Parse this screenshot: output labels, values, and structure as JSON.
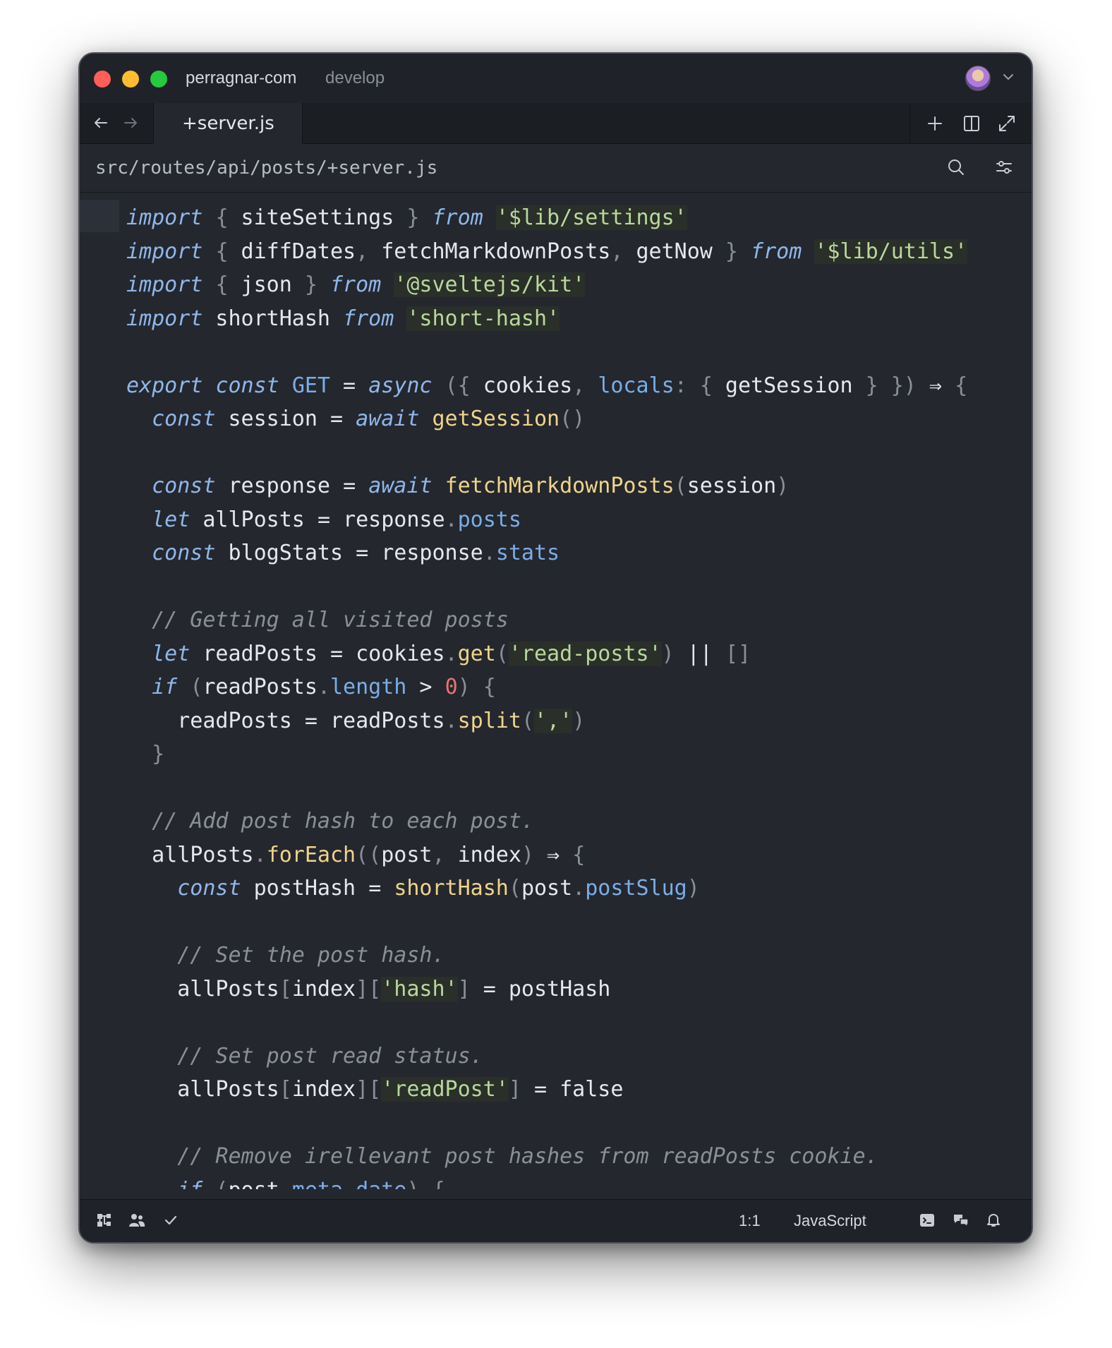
{
  "window": {
    "project_name": "perragnar-com",
    "branch_name": "develop"
  },
  "tabs": [
    {
      "label": "+server.js",
      "active": true
    }
  ],
  "path_bar": {
    "path": "src/routes/api/posts/+server.js"
  },
  "icons": {
    "back": "arrow-left-icon",
    "forward": "arrow-right-icon",
    "new_tab": "plus-icon",
    "split": "split-pane-icon",
    "expand": "expand-icon",
    "search": "search-icon",
    "settings": "sliders-icon",
    "project_tree": "project-tree-icon",
    "collab": "people-icon",
    "diagnostics": "check-icon",
    "terminal": "terminal-icon",
    "assistant": "chat-icon",
    "notifications": "bell-icon"
  },
  "colors": {
    "editor_bg": "#24272e",
    "keyword": "#8fb7ea",
    "function": "#f0d48a",
    "string": "#b8d89b",
    "property": "#79aee8",
    "comment": "#8a8f98",
    "number": "#e57373"
  },
  "code_lines": [
    [
      [
        "kw",
        "import"
      ],
      [
        "op",
        " "
      ],
      [
        "pn",
        "{"
      ],
      [
        "id",
        " siteSettings "
      ],
      [
        "pn",
        "}"
      ],
      [
        "op",
        " "
      ],
      [
        "kw",
        "from"
      ],
      [
        "op",
        " "
      ],
      [
        "str",
        "'$lib/settings'"
      ]
    ],
    [
      [
        "kw",
        "import"
      ],
      [
        "op",
        " "
      ],
      [
        "pn",
        "{"
      ],
      [
        "id",
        " diffDates"
      ],
      [
        "pn",
        ","
      ],
      [
        "id",
        " fetchMarkdownPosts"
      ],
      [
        "pn",
        ","
      ],
      [
        "id",
        " getNow "
      ],
      [
        "pn",
        "}"
      ],
      [
        "op",
        " "
      ],
      [
        "kw",
        "from"
      ],
      [
        "op",
        " "
      ],
      [
        "str",
        "'$lib/utils'"
      ]
    ],
    [
      [
        "kw",
        "import"
      ],
      [
        "op",
        " "
      ],
      [
        "pn",
        "{"
      ],
      [
        "id",
        " json "
      ],
      [
        "pn",
        "}"
      ],
      [
        "op",
        " "
      ],
      [
        "kw",
        "from"
      ],
      [
        "op",
        " "
      ],
      [
        "str",
        "'@sveltejs/kit'"
      ]
    ],
    [
      [
        "kw",
        "import"
      ],
      [
        "id",
        " shortHash "
      ],
      [
        "kw",
        "from"
      ],
      [
        "op",
        " "
      ],
      [
        "str",
        "'short-hash'"
      ]
    ],
    [],
    [
      [
        "kw",
        "export"
      ],
      [
        "op",
        " "
      ],
      [
        "kw",
        "const"
      ],
      [
        "op",
        " "
      ],
      [
        "prop",
        "GET"
      ],
      [
        "op",
        " = "
      ],
      [
        "kw",
        "async"
      ],
      [
        "op",
        " "
      ],
      [
        "pn",
        "({"
      ],
      [
        "id",
        " cookies"
      ],
      [
        "pn",
        ","
      ],
      [
        "op",
        " "
      ],
      [
        "prop",
        "locals"
      ],
      [
        "pn",
        ":"
      ],
      [
        "op",
        " "
      ],
      [
        "pn",
        "{"
      ],
      [
        "id",
        " getSession "
      ],
      [
        "pn",
        "}"
      ],
      [
        "op",
        " "
      ],
      [
        "pn",
        "})"
      ],
      [
        "op",
        " ⇒ "
      ],
      [
        "pn",
        "{"
      ]
    ],
    [
      [
        "op",
        "  "
      ],
      [
        "kw",
        "const"
      ],
      [
        "id",
        " session "
      ],
      [
        "op",
        "= "
      ],
      [
        "kw",
        "await"
      ],
      [
        "op",
        " "
      ],
      [
        "fn",
        "getSession"
      ],
      [
        "pn",
        "()"
      ]
    ],
    [],
    [
      [
        "op",
        "  "
      ],
      [
        "kw",
        "const"
      ],
      [
        "id",
        " response "
      ],
      [
        "op",
        "= "
      ],
      [
        "kw",
        "await"
      ],
      [
        "op",
        " "
      ],
      [
        "fn",
        "fetchMarkdownPosts"
      ],
      [
        "pn",
        "("
      ],
      [
        "id",
        "session"
      ],
      [
        "pn",
        ")"
      ]
    ],
    [
      [
        "op",
        "  "
      ],
      [
        "kw",
        "let"
      ],
      [
        "id",
        " allPosts "
      ],
      [
        "op",
        "= "
      ],
      [
        "id",
        "response"
      ],
      [
        "pn",
        "."
      ],
      [
        "prop",
        "posts"
      ]
    ],
    [
      [
        "op",
        "  "
      ],
      [
        "kw",
        "const"
      ],
      [
        "id",
        " blogStats "
      ],
      [
        "op",
        "= "
      ],
      [
        "id",
        "response"
      ],
      [
        "pn",
        "."
      ],
      [
        "prop",
        "stats"
      ]
    ],
    [],
    [
      [
        "op",
        "  "
      ],
      [
        "cm",
        "// Getting all visited posts"
      ]
    ],
    [
      [
        "op",
        "  "
      ],
      [
        "kw",
        "let"
      ],
      [
        "id",
        " readPosts "
      ],
      [
        "op",
        "= "
      ],
      [
        "id",
        "cookies"
      ],
      [
        "pn",
        "."
      ],
      [
        "fn",
        "get"
      ],
      [
        "pn",
        "("
      ],
      [
        "str",
        "'read-posts'"
      ],
      [
        "pn",
        ")"
      ],
      [
        "op",
        " || "
      ],
      [
        "pn",
        "[]"
      ]
    ],
    [
      [
        "op",
        "  "
      ],
      [
        "kw",
        "if"
      ],
      [
        "op",
        " "
      ],
      [
        "pn",
        "("
      ],
      [
        "id",
        "readPosts"
      ],
      [
        "pn",
        "."
      ],
      [
        "prop",
        "length"
      ],
      [
        "op",
        " > "
      ],
      [
        "num",
        "0"
      ],
      [
        "pn",
        ")"
      ],
      [
        "op",
        " "
      ],
      [
        "pn",
        "{"
      ]
    ],
    [
      [
        "op",
        "    "
      ],
      [
        "id",
        "readPosts "
      ],
      [
        "op",
        "= "
      ],
      [
        "id",
        "readPosts"
      ],
      [
        "pn",
        "."
      ],
      [
        "fn",
        "split"
      ],
      [
        "pn",
        "("
      ],
      [
        "str",
        "','"
      ],
      [
        "pn",
        ")"
      ]
    ],
    [
      [
        "op",
        "  "
      ],
      [
        "pn",
        "}"
      ]
    ],
    [],
    [
      [
        "op",
        "  "
      ],
      [
        "cm",
        "// Add post hash to each post."
      ]
    ],
    [
      [
        "op",
        "  "
      ],
      [
        "id",
        "allPosts"
      ],
      [
        "pn",
        "."
      ],
      [
        "fn",
        "forEach"
      ],
      [
        "pn",
        "(("
      ],
      [
        "id",
        "post"
      ],
      [
        "pn",
        ","
      ],
      [
        "id",
        " index"
      ],
      [
        "pn",
        ")"
      ],
      [
        "op",
        " ⇒ "
      ],
      [
        "pn",
        "{"
      ]
    ],
    [
      [
        "op",
        "    "
      ],
      [
        "kw",
        "const"
      ],
      [
        "id",
        " postHash "
      ],
      [
        "op",
        "= "
      ],
      [
        "fn",
        "shortHash"
      ],
      [
        "pn",
        "("
      ],
      [
        "id",
        "post"
      ],
      [
        "pn",
        "."
      ],
      [
        "prop",
        "postSlug"
      ],
      [
        "pn",
        ")"
      ]
    ],
    [],
    [
      [
        "op",
        "    "
      ],
      [
        "cm",
        "// Set the post hash."
      ]
    ],
    [
      [
        "op",
        "    "
      ],
      [
        "id",
        "allPosts"
      ],
      [
        "pn",
        "["
      ],
      [
        "id",
        "index"
      ],
      [
        "pn",
        "]["
      ],
      [
        "str",
        "'hash'"
      ],
      [
        "pn",
        "]"
      ],
      [
        "op",
        " = "
      ],
      [
        "id",
        "postHash"
      ]
    ],
    [],
    [
      [
        "op",
        "    "
      ],
      [
        "cm",
        "// Set post read status."
      ]
    ],
    [
      [
        "op",
        "    "
      ],
      [
        "id",
        "allPosts"
      ],
      [
        "pn",
        "["
      ],
      [
        "id",
        "index"
      ],
      [
        "pn",
        "]["
      ],
      [
        "str",
        "'readPost'"
      ],
      [
        "pn",
        "]"
      ],
      [
        "op",
        " = "
      ],
      [
        "id",
        "false"
      ]
    ],
    [],
    [
      [
        "op",
        "    "
      ],
      [
        "cm",
        "// Remove irellevant post hashes from readPosts cookie."
      ]
    ],
    [
      [
        "op",
        "    "
      ],
      [
        "kw",
        "if"
      ],
      [
        "op",
        " "
      ],
      [
        "pn",
        "("
      ],
      [
        "id",
        "post"
      ],
      [
        "pn",
        "."
      ],
      [
        "prop",
        "meta"
      ],
      [
        "pn",
        "."
      ],
      [
        "prop",
        "date"
      ],
      [
        "pn",
        ")"
      ],
      [
        "op",
        " "
      ],
      [
        "pn",
        "{"
      ]
    ]
  ],
  "status_bar": {
    "cursor_position": "1:1",
    "language": "JavaScript"
  }
}
